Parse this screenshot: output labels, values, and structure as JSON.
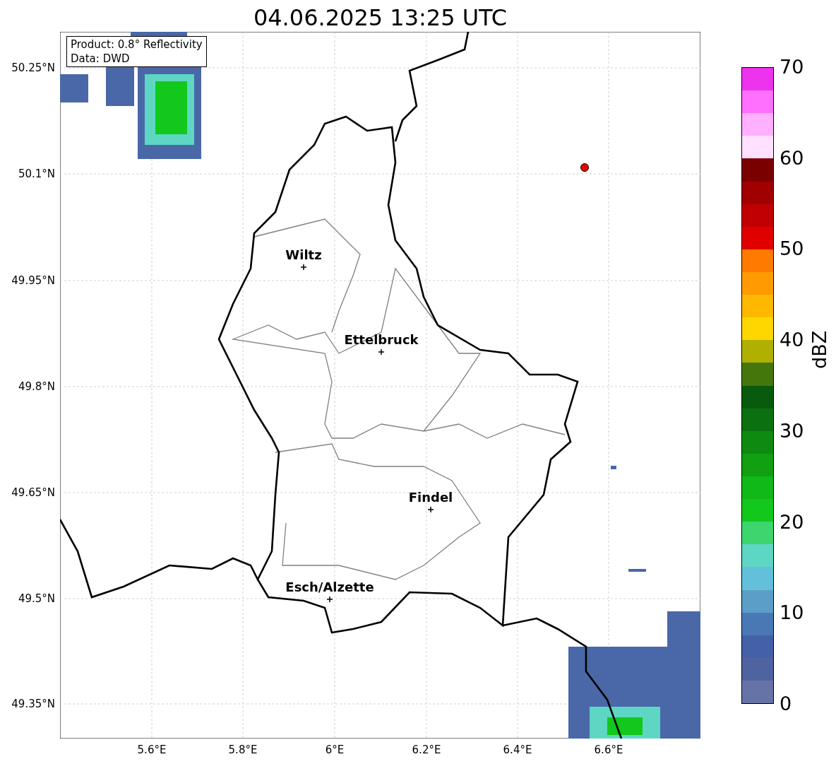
{
  "title": "04.06.2025 13:25 UTC",
  "info_box": [
    "Product: 0.8° Reflectivity",
    "Data: DWD"
  ],
  "y_ticks": [
    "50.25°N",
    "50.1°N",
    "49.95°N",
    "49.8°N",
    "49.65°N",
    "49.5°N",
    "49.35°N"
  ],
  "x_ticks": [
    "5.6°E",
    "5.8°E",
    "6°E",
    "6.2°E",
    "6.4°E",
    "6.6°E"
  ],
  "cities": [
    {
      "name": "Wiltz"
    },
    {
      "name": "Ettelbruck"
    },
    {
      "name": "Findel"
    },
    {
      "name": "Esch/Alzette"
    }
  ],
  "colorbar": {
    "label": "dBZ",
    "ticks": [
      "70",
      "60",
      "50",
      "40",
      "30",
      "20",
      "10",
      "0"
    ],
    "segments": [
      {
        "color": "#ee33ee"
      },
      {
        "color": "#ff70ff"
      },
      {
        "color": "#ffb0ff"
      },
      {
        "color": "#ffe0ff"
      },
      {
        "color": "#7a0000"
      },
      {
        "color": "#a00000"
      },
      {
        "color": "#c00000"
      },
      {
        "color": "#e00000"
      },
      {
        "color": "#ff7a00"
      },
      {
        "color": "#ff9a00"
      },
      {
        "color": "#ffb800"
      },
      {
        "color": "#ffd700"
      },
      {
        "color": "#b0b000"
      },
      {
        "color": "#45760c"
      },
      {
        "color": "#085a0c"
      },
      {
        "color": "#0b7010"
      },
      {
        "color": "#0e8a10"
      },
      {
        "color": "#10a012"
      },
      {
        "color": "#10b818"
      },
      {
        "color": "#13c81c"
      },
      {
        "color": "#3dd56d"
      },
      {
        "color": "#5ed6c4"
      },
      {
        "color": "#63c0db"
      },
      {
        "color": "#5b9fc9"
      },
      {
        "color": "#4a78b4"
      },
      {
        "color": "#4360a8"
      },
      {
        "color": "#4f63a0"
      },
      {
        "color": "#6673a6"
      }
    ]
  }
}
